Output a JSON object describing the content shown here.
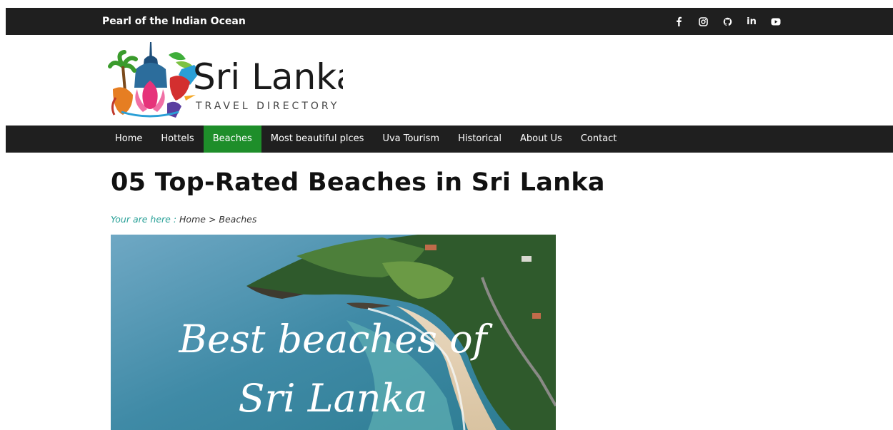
{
  "topbar": {
    "tagline": "Pearl of the Indian Ocean",
    "social": [
      {
        "name": "facebook-icon",
        "glyph": "f"
      },
      {
        "name": "instagram-icon",
        "glyph": "◎"
      },
      {
        "name": "github-icon",
        "glyph": "ᘓ"
      },
      {
        "name": "linkedin-icon",
        "glyph": "in"
      },
      {
        "name": "youtube-icon",
        "glyph": "▶"
      }
    ]
  },
  "logo": {
    "title": "Sri Lanka",
    "subtitle": "TRAVEL DIRECTORY"
  },
  "nav": {
    "items": [
      "Home",
      "Hottels",
      "Beaches",
      "Most beautiful plces",
      "Uva Tourism",
      "Historical",
      "About Us",
      "Contact"
    ],
    "active": "Beaches"
  },
  "page": {
    "title": "05 Top-Rated Beaches in Sri Lanka"
  },
  "breadcrumb": {
    "label": "Your are here :",
    "home": "Home",
    "separator": ">",
    "current": "Beaches"
  },
  "hero": {
    "line1": "Best beaches of",
    "line2": "Sri Lanka"
  },
  "colors": {
    "bar": "#1f1f1f",
    "active_nav": "#1e8e2a",
    "breadcrumb_label": "#2aa198"
  }
}
